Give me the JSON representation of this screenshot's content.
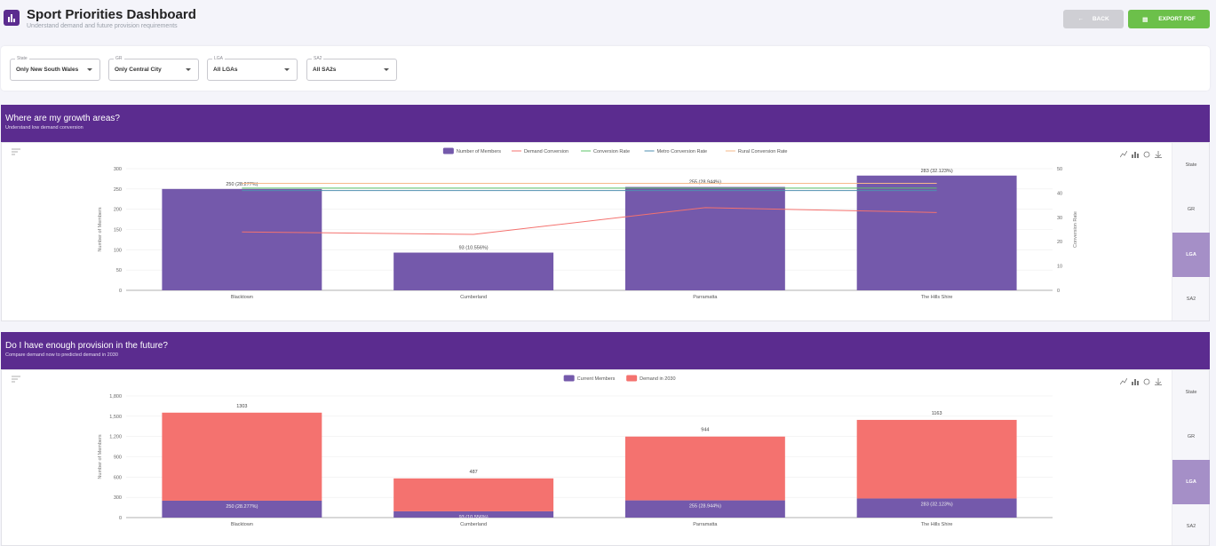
{
  "header": {
    "title": "Sport Priorities Dashboard",
    "subtitle": "Understand demand and future provision requirements",
    "back_label": "BACK",
    "export_label": "EXPORT PDF"
  },
  "filters": [
    {
      "label": "State",
      "value": "Only New South Wales"
    },
    {
      "label": "GR",
      "value": "Only Central City"
    },
    {
      "label": "LGA",
      "value": "All LGAs"
    },
    {
      "label": "SA2",
      "value": "All SA2s"
    }
  ],
  "side_tabs": [
    "State",
    "GR",
    "LGA",
    "SA2"
  ],
  "side_tab_active": "LGA",
  "colors": {
    "purple": "#5b2c8f",
    "bar_purple": "#7459ab",
    "demand_red": "#f4726f",
    "conversion_green": "#5cc46a",
    "metro_blue": "#4f8fb0",
    "rural_orange": "#f6b98a",
    "export_green": "#6cc04a"
  },
  "icons": [
    "chart-logo-icon",
    "back-arrow-icon",
    "export-icon",
    "menu-lines-icon",
    "line-chart-icon",
    "bar-chart-icon",
    "refresh-icon",
    "download-icon"
  ],
  "panels": [
    {
      "title": "Where are my growth areas?",
      "subtitle": "Understand low demand conversion"
    },
    {
      "title": "Do I have enough provision in the future?",
      "subtitle": "Compare demand now to predicted demand in 2030"
    }
  ],
  "chart_data": [
    {
      "type": "bar",
      "categories": [
        "Blacktown",
        "Cumberland",
        "Parramatta",
        "The Hills Shire"
      ],
      "series": [
        {
          "name": "Number of Members",
          "kind": "bar",
          "axis": "left",
          "values": [
            250,
            93,
            255,
            283
          ],
          "labels": [
            "250 (28.277%)",
            "93 (10.556%)",
            "255 (28.944%)",
            "283 (32.123%)"
          ]
        },
        {
          "name": "Demand Conversion",
          "kind": "line",
          "axis": "right",
          "values": [
            24,
            23,
            34,
            32
          ]
        },
        {
          "name": "Conversion Rate",
          "kind": "line",
          "axis": "right",
          "values": [
            42,
            42,
            42,
            42
          ]
        },
        {
          "name": "Metro Conversion Rate",
          "kind": "line",
          "axis": "right",
          "values": [
            41,
            41,
            41,
            41
          ]
        },
        {
          "name": "Rural Conversion Rate",
          "kind": "line",
          "axis": "right",
          "values": [
            44,
            44,
            44,
            44
          ]
        }
      ],
      "ylabel": "Number of Members",
      "y2label": "Conversion Rate",
      "ylim": [
        0,
        300
      ],
      "y2lim": [
        0,
        50
      ],
      "yticks": [
        "0",
        "50",
        "100",
        "150",
        "200",
        "250",
        "300"
      ],
      "y2ticks": [
        "0",
        "10",
        "20",
        "30",
        "40",
        "50"
      ],
      "legend": "top-center",
      "grid": true
    },
    {
      "type": "bar",
      "stacked": true,
      "categories": [
        "Blacktown",
        "Cumberland",
        "Parramatta",
        "The Hills Shire"
      ],
      "series": [
        {
          "name": "Current Members",
          "values": [
            250,
            93,
            255,
            283
          ],
          "labels": [
            "250 (28.277%)",
            "93 (10.556%)",
            "255 (28.944%)",
            "283 (32.123%)"
          ]
        },
        {
          "name": "Demand in 2030",
          "values": [
            1303,
            487,
            944,
            1163
          ],
          "labels": [
            "1303",
            "487",
            "944",
            "1163"
          ]
        }
      ],
      "ylabel": "Number of Members",
      "ylim": [
        0,
        1800
      ],
      "yticks": [
        "0",
        "300",
        "600",
        "900",
        "1,200",
        "1,500",
        "1,800"
      ],
      "legend": "top-center",
      "grid": true
    }
  ]
}
